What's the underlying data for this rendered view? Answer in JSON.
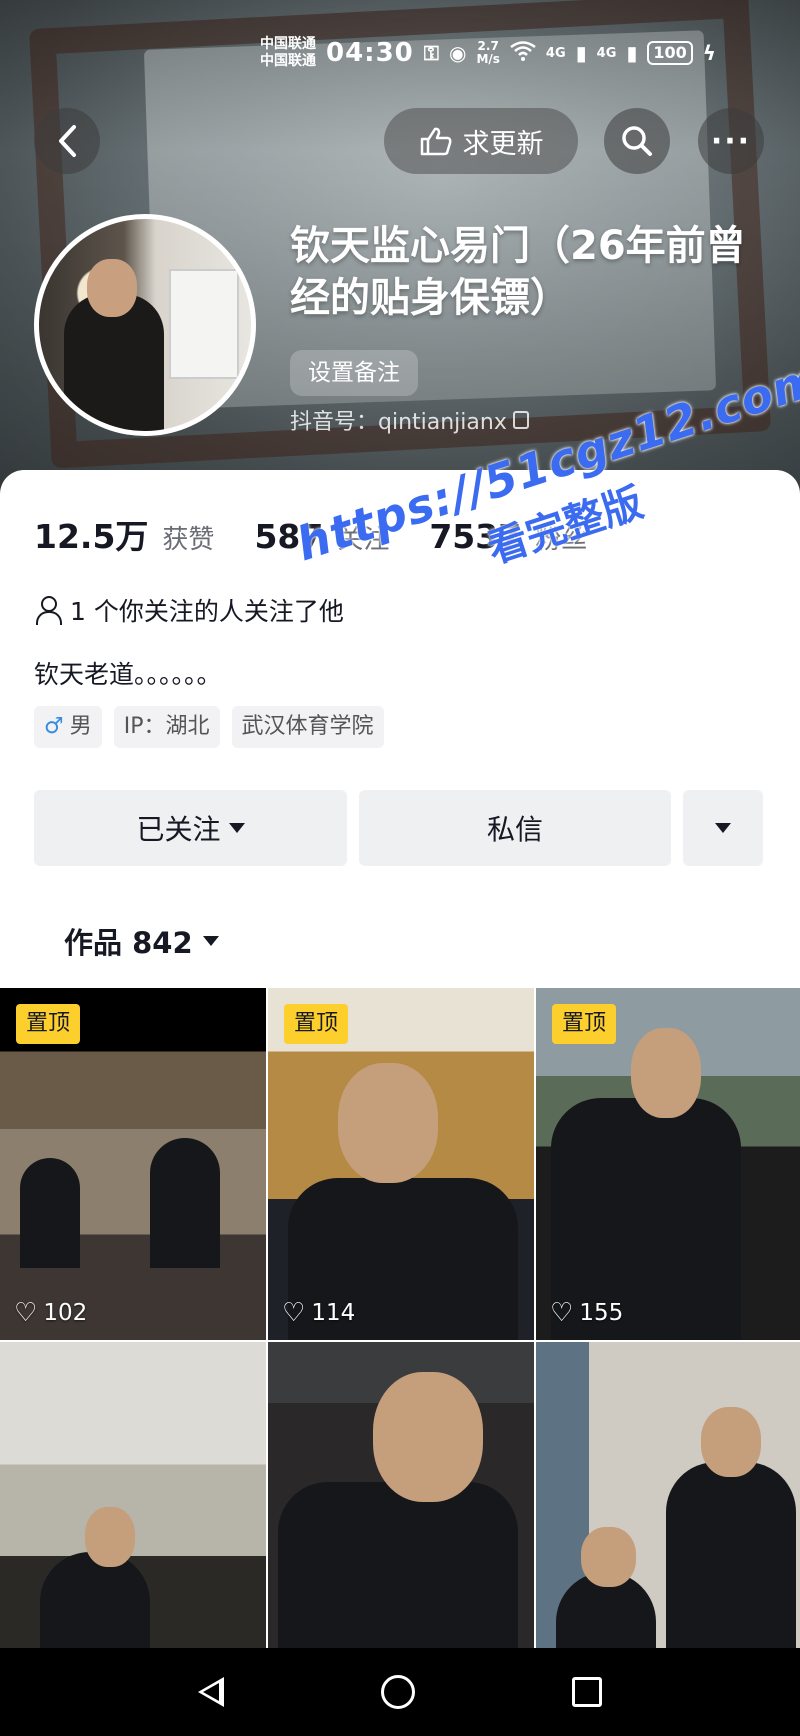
{
  "status_bar": {
    "carrier_1": "中国联通",
    "carrier_2": "中国联通",
    "time": "04:30",
    "speed_value": "2.7",
    "speed_unit": "M/s",
    "signal_1": "4G",
    "signal_2": "4G",
    "battery": "100"
  },
  "header": {
    "update_label": "求更新",
    "name": "钦天监心易门（26年前曾经的贴身保镖）",
    "remark_label": "设置备注",
    "douyin_id": "抖音号：qintianjianx"
  },
  "stats": {
    "likes_num": "12.5万",
    "likes_label": "获赞",
    "following_num": "587",
    "following_label": "关注",
    "followers_num": "7537",
    "followers_label": "粉丝"
  },
  "profile": {
    "mutual": "1 个你关注的人关注了他",
    "bio": "钦天老道。。。。。。",
    "gender": "男",
    "ip": "IP：湖北",
    "school": "武汉体育学院"
  },
  "actions": {
    "follow_label": "已关注",
    "message_label": "私信"
  },
  "works": {
    "label": "作品 842"
  },
  "watermark": {
    "line1": "https://51cgz12.com",
    "line2": "看完整版"
  },
  "videos": [
    {
      "pinned": "置顶",
      "likes": "102"
    },
    {
      "pinned": "置顶",
      "likes": "114"
    },
    {
      "pinned": "置顶",
      "likes": "155"
    },
    {
      "pinned": "",
      "likes": ""
    },
    {
      "pinned": "",
      "likes": ""
    },
    {
      "pinned": "",
      "likes": ""
    }
  ],
  "icons": {
    "back": "chevron-left-icon",
    "update": "thumb-icon",
    "search": "search-icon",
    "more": "more-icon",
    "copy": "copy-icon",
    "person": "person-icon",
    "male": "male-icon",
    "heart": "heart-icon"
  },
  "colors": {
    "pin_badge": "#fccf2d",
    "watermark": "#3b6bf0",
    "gender_male": "#3a8dde"
  }
}
